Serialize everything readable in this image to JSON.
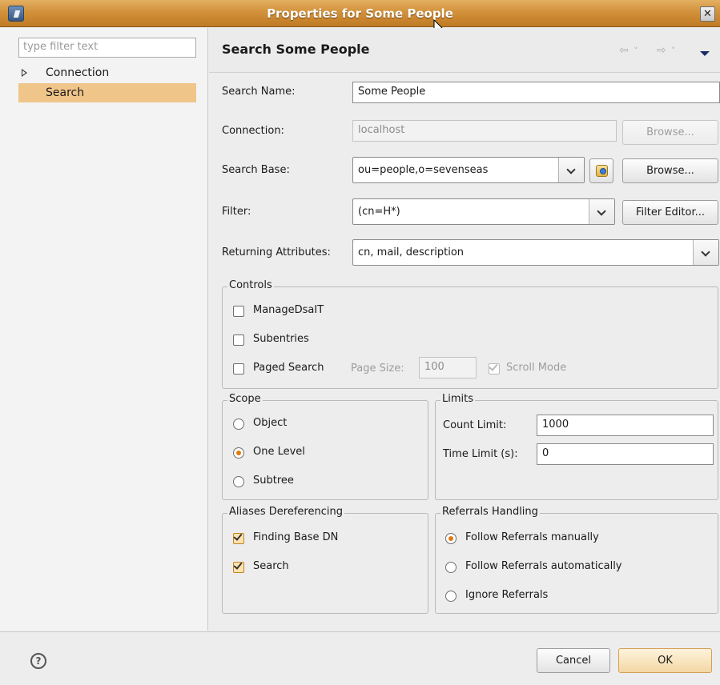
{
  "window": {
    "title": "Properties for Some People",
    "close_glyph": "✕"
  },
  "sidebar": {
    "filter_placeholder": "type filter text",
    "items": [
      {
        "label": "Connection",
        "expandable": true,
        "selected": false
      },
      {
        "label": "Search",
        "expandable": false,
        "selected": true
      }
    ]
  },
  "page": {
    "title": "Search Some People",
    "nav": {
      "back": "⇦",
      "back_menu": "˅",
      "forward": "⇨",
      "forward_menu": "˅"
    }
  },
  "form": {
    "search_name": {
      "label": "Search Name:",
      "value": "Some People"
    },
    "connection": {
      "label": "Connection:",
      "value": "localhost",
      "browse": "Browse..."
    },
    "search_base": {
      "label": "Search Base:",
      "value": "ou=people,o=sevenseas",
      "browse": "Browse..."
    },
    "filter": {
      "label": "Filter:",
      "value": "(cn=H*)",
      "editor": "Filter Editor..."
    },
    "returning_attributes": {
      "label": "Returning Attributes:",
      "value": "cn, mail, description"
    }
  },
  "controls": {
    "legend": "Controls",
    "manage_dsait": {
      "label": "ManageDsaIT",
      "checked": false
    },
    "subentries": {
      "label": "Subentries",
      "checked": false
    },
    "paged_search": {
      "label": "Paged Search",
      "checked": false
    },
    "page_size_label": "Page Size:",
    "page_size_value": "100",
    "scroll_mode": {
      "label": "Scroll Mode",
      "checked": true,
      "enabled": false
    }
  },
  "scope": {
    "legend": "Scope",
    "options": [
      {
        "label": "Object",
        "selected": false
      },
      {
        "label": "One Level",
        "selected": true
      },
      {
        "label": "Subtree",
        "selected": false
      }
    ]
  },
  "limits": {
    "legend": "Limits",
    "count_label": "Count Limit:",
    "count_value": "1000",
    "time_label": "Time Limit (s):",
    "time_value": "0"
  },
  "aliases": {
    "legend": "Aliases Dereferencing",
    "finding_base_dn": {
      "label": "Finding Base DN",
      "checked": true
    },
    "search": {
      "label": "Search",
      "checked": true
    }
  },
  "referrals": {
    "legend": "Referrals Handling",
    "options": [
      {
        "label": "Follow Referrals manually",
        "selected": true
      },
      {
        "label": "Follow Referrals automatically",
        "selected": false
      },
      {
        "label": "Ignore Referrals",
        "selected": false
      }
    ]
  },
  "footer": {
    "help_glyph": "?",
    "cancel": "Cancel",
    "ok": "OK"
  }
}
